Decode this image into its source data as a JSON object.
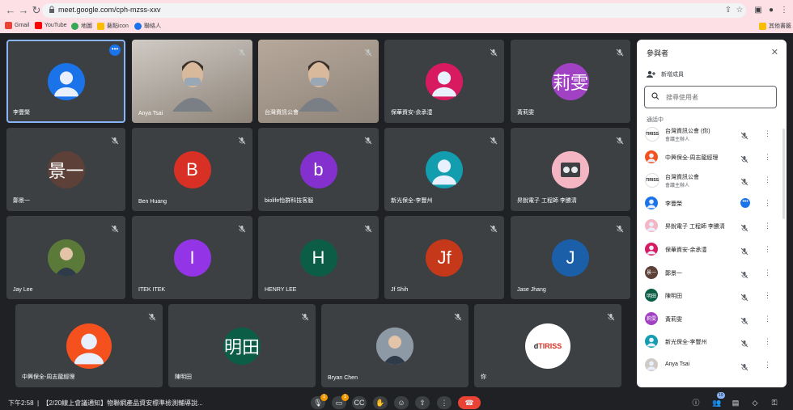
{
  "browser": {
    "url": "meet.google.com/cph-mzss-xxv",
    "bookmarks": [
      "Gmail",
      "YouTube",
      "地圖",
      "藝點icon",
      "聯絡人"
    ],
    "other_bookmarks": "其他書籤"
  },
  "tiles": [
    {
      "name": "李豐榮",
      "type": "avatar",
      "color": "#1a73e8",
      "glyph": ""
    },
    {
      "name": "Anya Tsai",
      "type": "video",
      "color": "#cfcac4",
      "glyph": ""
    },
    {
      "name": "台灣資訊公會",
      "type": "video",
      "color": "#b7a89b",
      "glyph": ""
    },
    {
      "name": "保華資安-余承澧",
      "type": "avatar",
      "color": "#d81b60",
      "glyph": ""
    },
    {
      "name": "黃莉雯",
      "type": "avatar",
      "color": "#a142c4",
      "glyph": "莉雯"
    },
    {
      "name": "鄭景一",
      "type": "avatar",
      "color": "#5d4037",
      "glyph": "景一"
    },
    {
      "name": "Ben Huang",
      "type": "avatar",
      "color": "#d93025",
      "glyph": "B"
    },
    {
      "name": "biolife怡群科技客服",
      "type": "avatar",
      "color": "#8430ce",
      "glyph": "b"
    },
    {
      "name": "新光保全-李豐州",
      "type": "avatar",
      "color": "#129eaf",
      "glyph": ""
    },
    {
      "name": "昇銳電子 工程師 李勝清",
      "type": "avatar",
      "color": "#f4b6c2",
      "glyph": ""
    },
    {
      "name": "Jay Lee",
      "type": "photo",
      "color": "#5b7a3a",
      "glyph": ""
    },
    {
      "name": "ITEK ITEK",
      "type": "avatar",
      "color": "#9334e6",
      "glyph": "I"
    },
    {
      "name": "HENRY LEE",
      "type": "avatar",
      "color": "#0b5e45",
      "glyph": "H"
    },
    {
      "name": "Jf Shih",
      "type": "avatar",
      "color": "#c5381a",
      "glyph": "Jf"
    },
    {
      "name": "Jase Jhang",
      "type": "avatar",
      "color": "#1a5fa8",
      "glyph": "J"
    },
    {
      "name": "中興保全-周志龍經理",
      "type": "avatar",
      "color": "#f4511e",
      "glyph": ""
    },
    {
      "name": "陳明田",
      "type": "avatar",
      "color": "#0b5e45",
      "glyph": "明田"
    },
    {
      "name": "Bryan Chen",
      "type": "photo",
      "color": "#8d9aa6",
      "glyph": ""
    },
    {
      "name": "你",
      "type": "logo",
      "color": "#ffffff",
      "glyph": "TIRISS"
    }
  ],
  "bottom": {
    "time": "下午2:58",
    "meeting_title": "【2/20線上會議通知】物聯網產品資安標準檢測輔導說...",
    "participants_count": "19",
    "badges": [
      "1",
      "1"
    ]
  },
  "panel": {
    "title": "參與者",
    "add_member": "新增成員",
    "search_placeholder": "搜尋使用者",
    "section_label": "通話中",
    "participants": [
      {
        "name": "台灣資訊公會 (你)",
        "role": "會議主辦人",
        "color": "#ffffff",
        "glyph": "TIRISS",
        "status": "muted"
      },
      {
        "name": "中興保全-周志龍經理",
        "role": "",
        "color": "#f4511e",
        "glyph": "",
        "status": "muted"
      },
      {
        "name": "台灣資訊公會",
        "role": "會議主辦人",
        "color": "#ffffff",
        "glyph": "TIRISS",
        "status": "muted"
      },
      {
        "name": "李豐榮",
        "role": "",
        "color": "#1a73e8",
        "glyph": "",
        "status": "speaking"
      },
      {
        "name": "昇銳電子 工程師 李勝清",
        "role": "",
        "color": "#f4b6c2",
        "glyph": "",
        "status": "muted"
      },
      {
        "name": "保華資安-余承澧",
        "role": "",
        "color": "#d81b60",
        "glyph": "",
        "status": "muted"
      },
      {
        "name": "鄭景一",
        "role": "",
        "color": "#5d4037",
        "glyph": "景一",
        "status": "muted"
      },
      {
        "name": "陳明田",
        "role": "",
        "color": "#0b5e45",
        "glyph": "明田",
        "status": "muted"
      },
      {
        "name": "黃莉雯",
        "role": "",
        "color": "#a142c4",
        "glyph": "莉雯",
        "status": "muted"
      },
      {
        "name": "新光保全-李豐州",
        "role": "",
        "color": "#129eaf",
        "glyph": "",
        "status": "muted"
      },
      {
        "name": "Anya Tsai",
        "role": "",
        "color": "#cfcac4",
        "glyph": "",
        "status": "muted"
      }
    ]
  }
}
